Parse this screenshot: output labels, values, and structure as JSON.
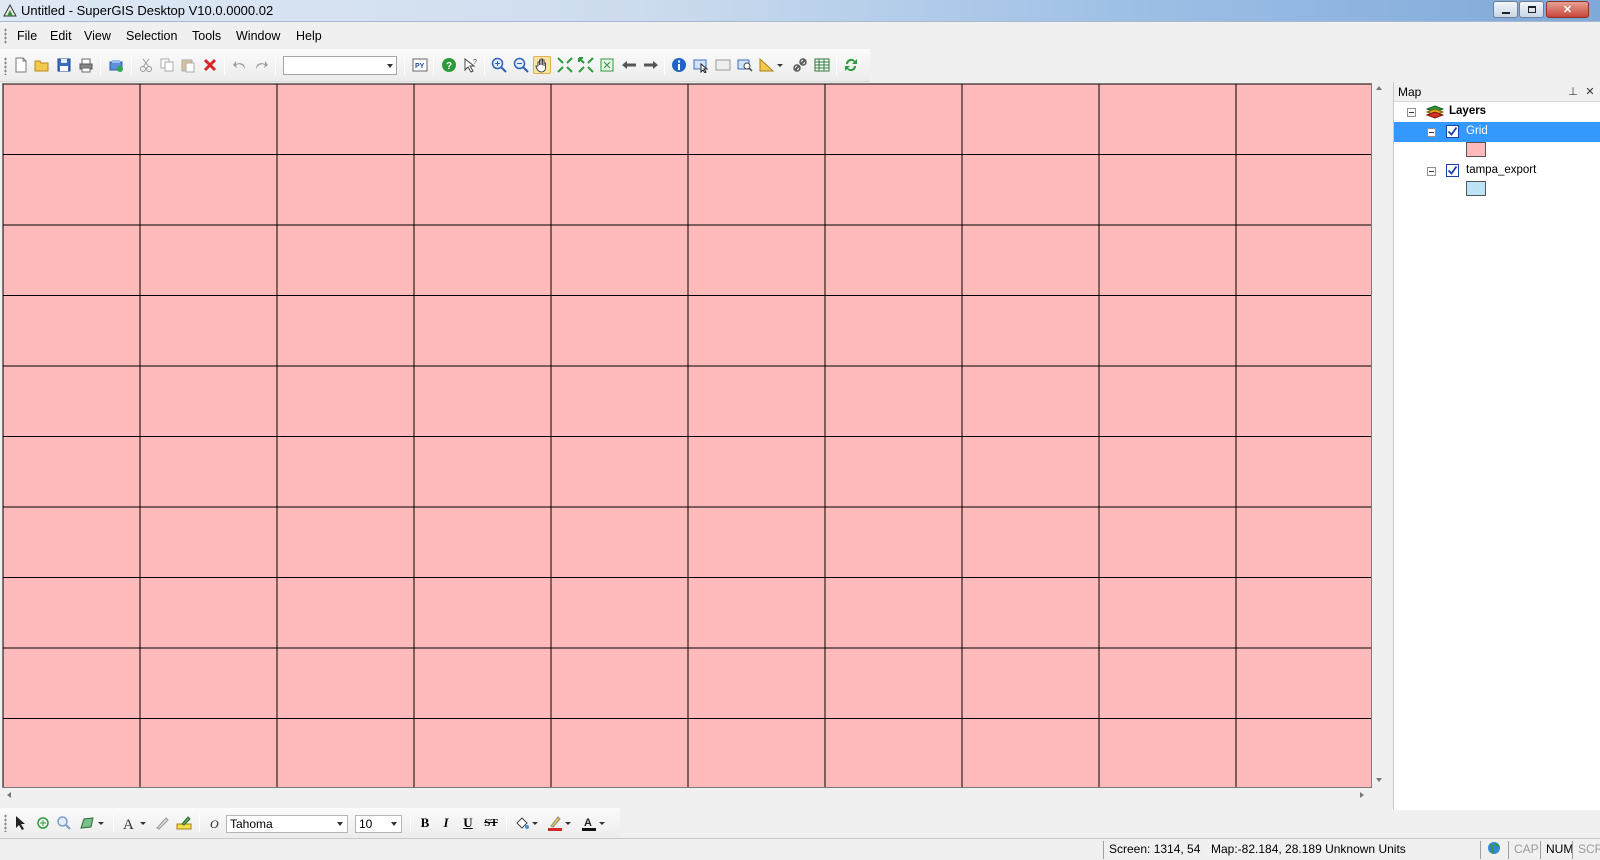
{
  "window": {
    "title": "Untitled - SuperGIS Desktop V10.0.0000.02",
    "controls": [
      "minimize",
      "restore",
      "close"
    ]
  },
  "menu": [
    "File",
    "Edit",
    "View",
    "Selection",
    "Tools",
    "Window",
    "Help"
  ],
  "toolbar": {
    "scale_value": "",
    "active_tool": "pan",
    "icons": [
      "new-document-icon",
      "open-folder-icon",
      "save-icon",
      "print-icon",
      "add-data-icon",
      "cut-icon",
      "copy-icon",
      "paste-icon",
      "delete-icon",
      "undo-icon",
      "redo-icon",
      "python-icon",
      "help-icon",
      "whats-this-icon",
      "zoom-in-icon",
      "zoom-out-icon",
      "pan-hand-icon",
      "fixed-zoom-in-icon",
      "fixed-zoom-out-icon",
      "full-extent-icon",
      "previous-extent-icon",
      "next-extent-icon",
      "identify-icon",
      "select-features-icon",
      "clear-selection-icon",
      "find-icon",
      "measure-icon",
      "hyperlink-icon",
      "attribute-table-icon",
      "refresh-icon"
    ]
  },
  "map": {
    "grid_fill": "#ffbbbb",
    "grid_stroke": "#000000",
    "columns": 10,
    "rows": 10
  },
  "panel": {
    "title": "Map",
    "root": "Layers",
    "layers": [
      {
        "name": "Grid",
        "checked": true,
        "selected": true,
        "symbol_color": "#ffbbbb"
      },
      {
        "name": "tampa_export",
        "checked": true,
        "selected": false,
        "symbol_color": "#bde3f7"
      }
    ]
  },
  "drawing": {
    "font_name": "Tahoma",
    "font_size": "10",
    "bold": "B",
    "italic": "I",
    "underline": "U",
    "strikethrough": "ST"
  },
  "status": {
    "screen": "Screen: 1314, 54",
    "map": "Map:-82.184, 28.189 Unknown Units",
    "cap": "CAP",
    "num": "NUM",
    "scrl": "SCRL"
  }
}
